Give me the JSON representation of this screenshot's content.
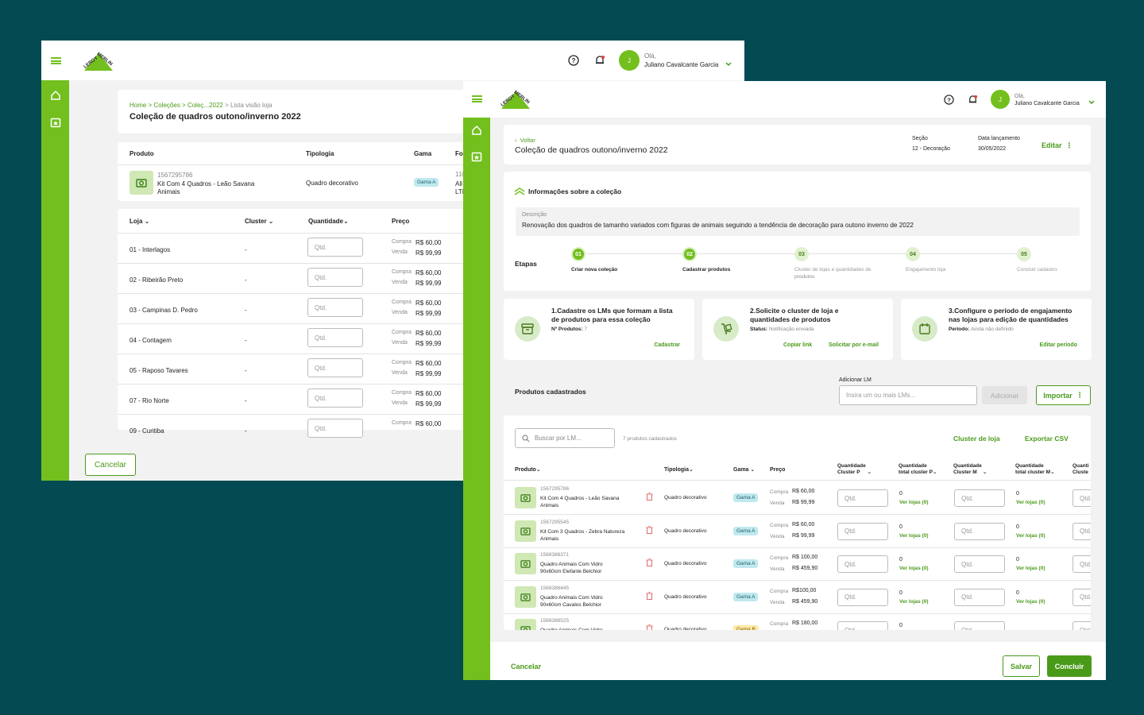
{
  "brand": {
    "logo_text_top": "LEROY",
    "logo_text_bottom": "MERLIN",
    "accent": "#72bf1e",
    "green_text": "#4a9a1a",
    "background": "#034a52"
  },
  "user": {
    "initial": "J",
    "greeting": "Olá,",
    "name": "Juliano Cavalcante Garcia"
  },
  "store_view": {
    "breadcrumb": {
      "home": "Home",
      "sep": " > ",
      "collections": "Coleções",
      "collection": "Coleç...2022",
      "current": "Lista visão loja"
    },
    "title": "Coleção de quadros outono/inverno 2022",
    "product_headers": {
      "produto": "Produto",
      "tipologia": "Tipologia",
      "gama": "Gama",
      "fo": "Fo"
    },
    "product": {
      "lm": "1567295786",
      "name_line1": "Kit Com 4 Quadros - Leão Savana",
      "name_line2": "Animais",
      "tipologia": "Quadro decorativo",
      "gama": "Gama A",
      "extra1": "110",
      "extra2": "All",
      "extra3": "LTI"
    },
    "store_headers": {
      "loja": "Loja",
      "cluster": "Cluster",
      "quantidade": "Quantidade",
      "preco": "Preço"
    },
    "qty_placeholder": "Qtd.",
    "price_labels": {
      "compra": "Compra",
      "venda": "Venda"
    },
    "stores": [
      {
        "name": "01 - Interlagos",
        "cluster": "-",
        "compra": "R$ 60,00",
        "venda": "R$ 99,99"
      },
      {
        "name": "02 - Ribeirão Preto",
        "cluster": "-",
        "compra": "R$ 60,00",
        "venda": "R$ 99,99"
      },
      {
        "name": "03 - Campinas D. Pedro",
        "cluster": "-",
        "compra": "R$ 60,00",
        "venda": "R$ 99,99"
      },
      {
        "name": "04 - Contagem",
        "cluster": "-",
        "compra": "R$ 60,00",
        "venda": "R$ 99,99"
      },
      {
        "name": "05 - Raposo Tavares",
        "cluster": "-",
        "compra": "R$ 60,00",
        "venda": "R$ 99,99"
      },
      {
        "name": "07 - Rio Norte",
        "cluster": "-",
        "compra": "R$ 60,00",
        "venda": "R$ 99,99"
      },
      {
        "name": "09 - Curitiba",
        "cluster": "-",
        "compra": "R$ 60,00",
        "venda": ""
      }
    ],
    "cancel": "Cancelar"
  },
  "detail": {
    "back": "Voltar",
    "title": "Coleção de quadros outono/inverno 2022",
    "secao_label": "Seção",
    "secao_value": "12 - Decoração",
    "data_label": "Data lançamento",
    "data_value": "30/05/2022",
    "edit": "Editar",
    "info_title": "Informações sobre a coleção",
    "desc_label": "Descrição",
    "desc_value": "Renovação dos quadros de tamanho variados com figuras de animais seguindo a tendência de decoração para outono inverno de 2022",
    "etapas": "Etapas",
    "steps": [
      {
        "num": "01",
        "label": "Criar nova coleção",
        "label2": ""
      },
      {
        "num": "02",
        "label": "Cadastrar produtos",
        "label2": ""
      },
      {
        "num": "03",
        "label": "Cluster de lojas e quantidades de",
        "label2": "produtos"
      },
      {
        "num": "04",
        "label": "Engajamento loja",
        "label2": ""
      },
      {
        "num": "05",
        "label": "Concluir cadastro",
        "label2": ""
      }
    ],
    "tasks": [
      {
        "title1": "1.Cadastre os LMs que formam a lista",
        "title2": "de produtos para essa coleção",
        "meta_label": "Nº Produtos:",
        "meta_value": "7",
        "action1": "",
        "action2": "Cadastrar"
      },
      {
        "title1": "2.Solicite o cluster de loja e",
        "title2": "quantidades de produtos",
        "meta_label": "Status:",
        "meta_value": "Notificação enviada",
        "action1": "Copiar link",
        "action2": "Solicitar por e-mail"
      },
      {
        "title1": "3.Configure o período de engajamento",
        "title2": "nas lojas para edição de quantidades",
        "meta_label": "Período:",
        "meta_value": "Ainda não definido",
        "action1": "",
        "action2": "Editar período"
      }
    ],
    "produtos_title": "Produtos cadastrados",
    "add_lm_label": "Adicionar LM",
    "add_lm_placeholder": "Insira um ou mais LMs...",
    "add_button": "Adicionar",
    "import_button": "Importar",
    "search_placeholder": "Buscar por LM...",
    "count_text": "7 produtos cadastrados",
    "cluster_link": "Cluster de loja",
    "export_link": "Exportar CSV",
    "headers": {
      "produto": "Produto",
      "tipologia": "Tipologia",
      "gama": "Gama",
      "preco": "Preço",
      "qcp1": "Quantidade",
      "qcp2": "Cluster P",
      "qtp1": "Quantidade",
      "qtp2": "total cluster P",
      "qcm1": "Quantidade",
      "qcm2": "Cluster M",
      "qtm1": "Quantidade",
      "qtm2": "total cluster M",
      "qn1": "Quanti",
      "qn2": "Cluste"
    },
    "ver_lojas": "Ver lojas (0)",
    "rows": [
      {
        "lm": "1567295786",
        "n1": "Kit Com 4 Quadros - Leão Savana",
        "n2": "Animais",
        "tip": "Quadro decorativo",
        "gama": "Gama A",
        "compra": "R$ 60,00",
        "venda": "R$ 99,99",
        "qp": "Qtd.",
        "tp": "0",
        "qm": "Qtd.",
        "tm": "0",
        "qn": "Qtd."
      },
      {
        "lm": "1567295545",
        "n1": "Kit Com 3 Quadros - Zebra Natureza",
        "n2": "Animais",
        "tip": "Quadro decorativo",
        "gama": "Gama A",
        "compra": "R$ 60,00",
        "venda": "R$ 99,99",
        "qp": "Qtd.",
        "tp": "0",
        "qm": "Qtd.",
        "tm": "0",
        "qn": "Qtd."
      },
      {
        "lm": "1568386371",
        "n1": "Quadro Animais Com Vidro",
        "n2": "90x60cm Elefante Belchior",
        "tip": "Quadro decorativo",
        "gama": "Gama A",
        "compra": "R$ 100,00",
        "venda": "R$ 459,90",
        "qp": "Qtd.",
        "tp": "0",
        "qm": "Qtd.",
        "tm": "0",
        "qn": "Qtd."
      },
      {
        "lm": "1568386445",
        "n1": "Quadro Animais Com Vidro",
        "n2": "90x60cm Cavalos Belchior",
        "tip": "Quadro decorativo",
        "gama": "Gama A",
        "compra": "R$100,00",
        "venda": "R$ 459,90",
        "qp": "Qtd.",
        "tp": "0",
        "qm": "Qtd.",
        "tm": "0",
        "qn": "Qtd."
      },
      {
        "lm": "1568386525",
        "n1": "Quadro Animais Com Vidro",
        "n2": "",
        "tip": "Quadro decorativo",
        "gama": "Gama B",
        "compra": "R$ 180,00",
        "venda": "",
        "qp": "Qtd.",
        "tp": "0",
        "qm": "Qtd.",
        "tm": "",
        "qn": "Qtd."
      }
    ],
    "cancel": "Cancelar",
    "save": "Salvar",
    "finish": "Concluir"
  }
}
